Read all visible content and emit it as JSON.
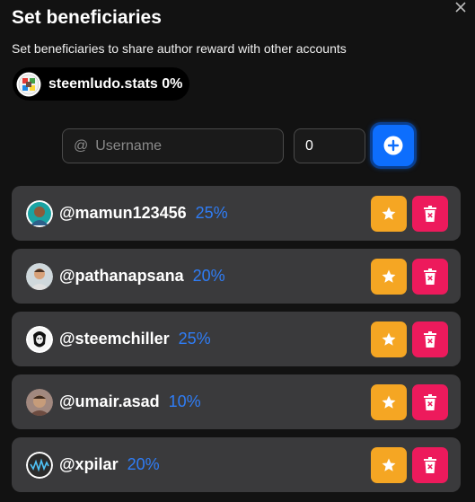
{
  "dialog": {
    "title": "Set beneficiaries",
    "subtitle": "Set beneficiaries to share author reward with other accounts",
    "owner_label": "steemludo.stats 0%"
  },
  "form": {
    "username_placeholder": "Username",
    "at_symbol": "@",
    "weight_value": "0"
  },
  "beneficiaries": [
    {
      "username": "@mamun123456",
      "percent": "25%"
    },
    {
      "username": "@pathanapsana",
      "percent": "20%"
    },
    {
      "username": "@steemchiller",
      "percent": "25%"
    },
    {
      "username": "@umair.asad",
      "percent": "10%"
    },
    {
      "username": "@xpilar",
      "percent": "20%"
    }
  ],
  "colors": {
    "background": "#121212",
    "row": "#3a3a3c",
    "accent_blue": "#0d6efd",
    "percent_blue": "#2f7df6",
    "star_button": "#f5a623",
    "delete_button": "#ed1a5c"
  },
  "icons": {
    "close": "close-icon",
    "add": "plus-circle-icon",
    "star": "star-icon",
    "delete": "trash-x-icon"
  }
}
